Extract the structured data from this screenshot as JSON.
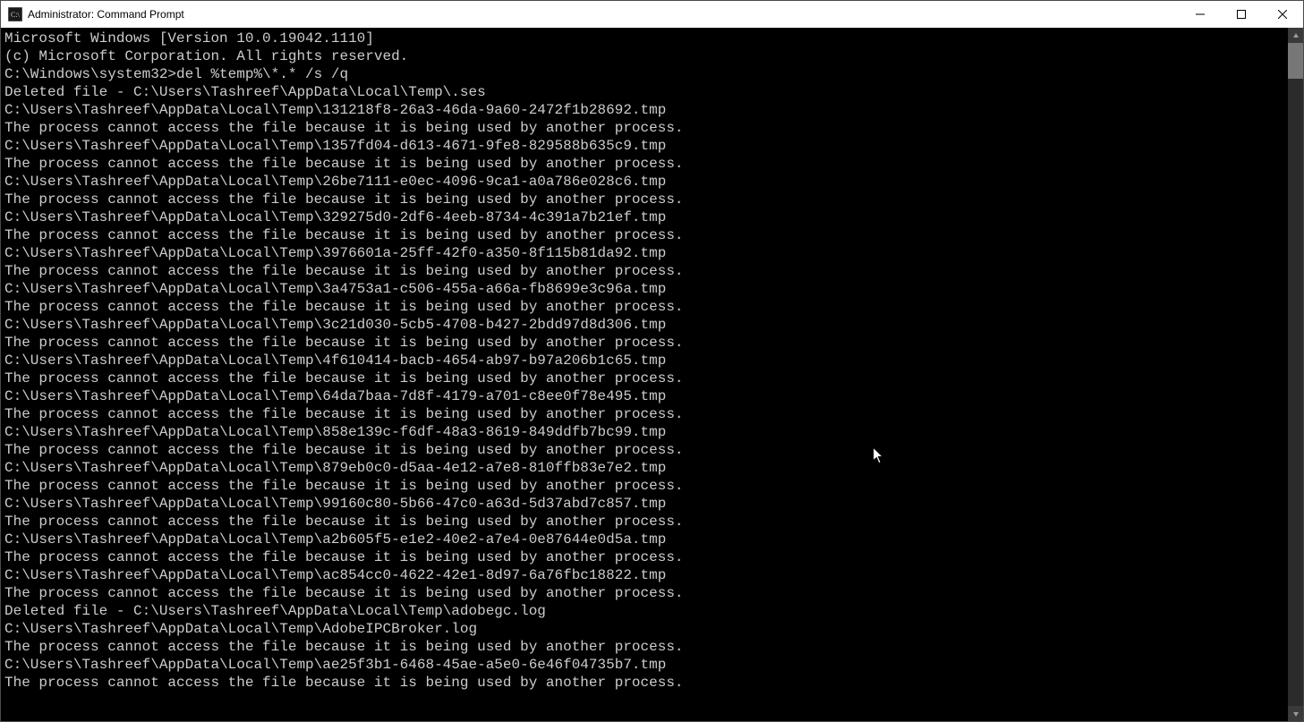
{
  "titlebar": {
    "title": "Administrator: Command Prompt"
  },
  "console": {
    "header1": "Microsoft Windows [Version 10.0.19042.1110]",
    "header2": "(c) Microsoft Corporation. All rights reserved.",
    "blank": "",
    "prompt": "C:\\Windows\\system32>",
    "command": "del %temp%\\*.* /s /q",
    "lines": [
      "Deleted file - C:\\Users\\Tashreef\\AppData\\Local\\Temp\\.ses",
      "C:\\Users\\Tashreef\\AppData\\Local\\Temp\\131218f8-26a3-46da-9a60-2472f1b28692.tmp",
      "The process cannot access the file because it is being used by another process.",
      "C:\\Users\\Tashreef\\AppData\\Local\\Temp\\1357fd04-d613-4671-9fe8-829588b635c9.tmp",
      "The process cannot access the file because it is being used by another process.",
      "C:\\Users\\Tashreef\\AppData\\Local\\Temp\\26be7111-e0ec-4096-9ca1-a0a786e028c6.tmp",
      "The process cannot access the file because it is being used by another process.",
      "C:\\Users\\Tashreef\\AppData\\Local\\Temp\\329275d0-2df6-4eeb-8734-4c391a7b21ef.tmp",
      "The process cannot access the file because it is being used by another process.",
      "C:\\Users\\Tashreef\\AppData\\Local\\Temp\\3976601a-25ff-42f0-a350-8f115b81da92.tmp",
      "The process cannot access the file because it is being used by another process.",
      "C:\\Users\\Tashreef\\AppData\\Local\\Temp\\3a4753a1-c506-455a-a66a-fb8699e3c96a.tmp",
      "The process cannot access the file because it is being used by another process.",
      "C:\\Users\\Tashreef\\AppData\\Local\\Temp\\3c21d030-5cb5-4708-b427-2bdd97d8d306.tmp",
      "The process cannot access the file because it is being used by another process.",
      "C:\\Users\\Tashreef\\AppData\\Local\\Temp\\4f610414-bacb-4654-ab97-b97a206b1c65.tmp",
      "The process cannot access the file because it is being used by another process.",
      "C:\\Users\\Tashreef\\AppData\\Local\\Temp\\64da7baa-7d8f-4179-a701-c8ee0f78e495.tmp",
      "The process cannot access the file because it is being used by another process.",
      "C:\\Users\\Tashreef\\AppData\\Local\\Temp\\858e139c-f6df-48a3-8619-849ddfb7bc99.tmp",
      "The process cannot access the file because it is being used by another process.",
      "C:\\Users\\Tashreef\\AppData\\Local\\Temp\\879eb0c0-d5aa-4e12-a7e8-810ffb83e7e2.tmp",
      "The process cannot access the file because it is being used by another process.",
      "C:\\Users\\Tashreef\\AppData\\Local\\Temp\\99160c80-5b66-47c0-a63d-5d37abd7c857.tmp",
      "The process cannot access the file because it is being used by another process.",
      "C:\\Users\\Tashreef\\AppData\\Local\\Temp\\a2b605f5-e1e2-40e2-a7e4-0e87644e0d5a.tmp",
      "The process cannot access the file because it is being used by another process.",
      "C:\\Users\\Tashreef\\AppData\\Local\\Temp\\ac854cc0-4622-42e1-8d97-6a76fbc18822.tmp",
      "The process cannot access the file because it is being used by another process.",
      "Deleted file - C:\\Users\\Tashreef\\AppData\\Local\\Temp\\adobegc.log",
      "C:\\Users\\Tashreef\\AppData\\Local\\Temp\\AdobeIPCBroker.log",
      "The process cannot access the file because it is being used by another process.",
      "C:\\Users\\Tashreef\\AppData\\Local\\Temp\\ae25f3b1-6468-45ae-a5e0-6e46f04735b7.tmp",
      "The process cannot access the file because it is being used by another process."
    ]
  }
}
